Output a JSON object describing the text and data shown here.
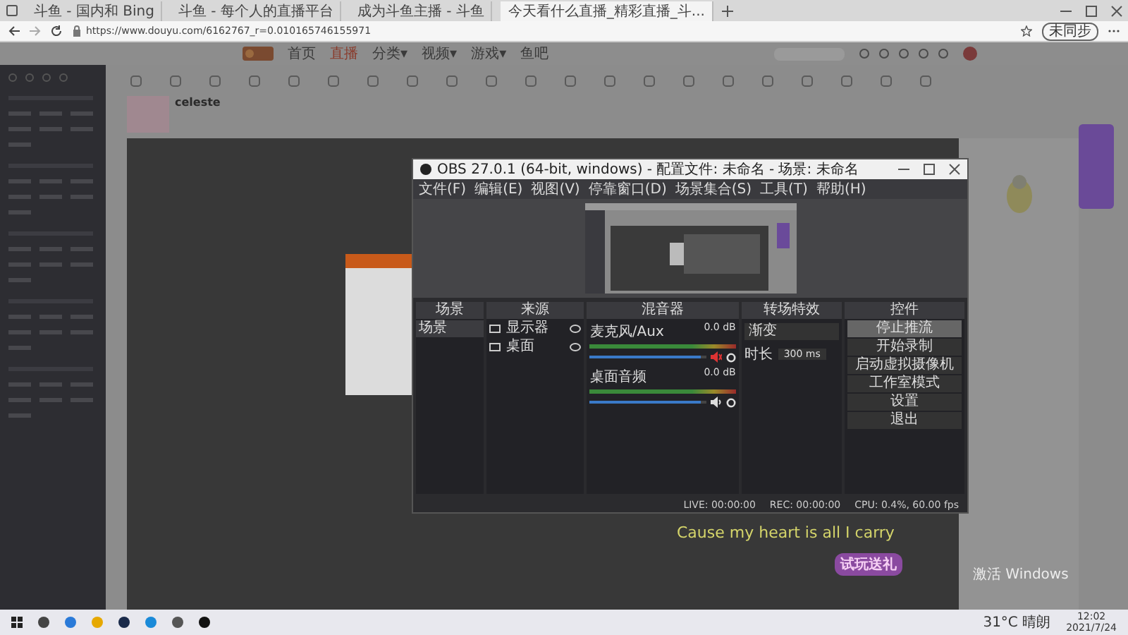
{
  "browser": {
    "tabs": [
      {
        "title": "斗鱼 - 国内和 Bing",
        "selected": false
      },
      {
        "title": "斗鱼 - 每个人的直播平台",
        "selected": false
      },
      {
        "title": "成为斗鱼主播 - 斗鱼",
        "selected": false
      },
      {
        "title": "今天看什么直播_精彩直播_斗...",
        "selected": true
      }
    ],
    "url": "https://www.douyu.com/6162767_r=0.010165746155971",
    "sync_button": "未同步"
  },
  "site": {
    "nav": [
      {
        "label": "首页",
        "selected": false
      },
      {
        "label": "直播",
        "selected": true
      },
      {
        "label": "分类▾",
        "selected": false
      },
      {
        "label": "视频▾",
        "selected": false
      },
      {
        "label": "游戏▾",
        "selected": false
      },
      {
        "label": "鱼吧",
        "selected": false
      }
    ],
    "streamer": "celeste"
  },
  "obs": {
    "title": "OBS 27.0.1 (64-bit, windows) - 配置文件: 未命名 - 场景: 未命名",
    "menu": [
      "文件(F)",
      "编辑(E)",
      "视图(V)",
      "停靠窗口(D)",
      "场景集合(S)",
      "工具(T)",
      "帮助(H)"
    ],
    "docks": [
      "场景",
      "来源",
      "混音器",
      "转场特效",
      "控件"
    ],
    "scenes": [
      {
        "name": "场景",
        "selected": true
      }
    ],
    "sources": [
      {
        "name": "显示器"
      },
      {
        "name": "桌面"
      }
    ],
    "mixer": [
      {
        "name": "麦克风/Aux",
        "reading": "0.0 dB",
        "level": 0.95,
        "muted": true
      },
      {
        "name": "桌面音频",
        "reading": "0.0 dB",
        "level": 0.95,
        "muted": false
      }
    ],
    "transition": {
      "value": "渐变",
      "duration_label": "时长",
      "duration": "300 ms"
    },
    "controls": [
      {
        "label": "停止推流",
        "active": true
      },
      {
        "label": "开始录制",
        "active": false
      },
      {
        "label": "启动虚拟摄像机",
        "active": false
      },
      {
        "label": "工作室模式",
        "active": false
      },
      {
        "label": "设置",
        "active": false
      },
      {
        "label": "退出",
        "active": false
      }
    ],
    "status": [
      "LIVE: 00:00:00",
      "REC: 00:00:00",
      "CPU: 0.4%, 60.00 fps"
    ]
  },
  "subtitle": "Cause my heart is all I carry",
  "ad": "试玩送礼",
  "activation": "激活 Windows",
  "taskbar": {
    "weather": "31°C 晴朗",
    "time": "12:02",
    "date": "2021/7/24"
  }
}
